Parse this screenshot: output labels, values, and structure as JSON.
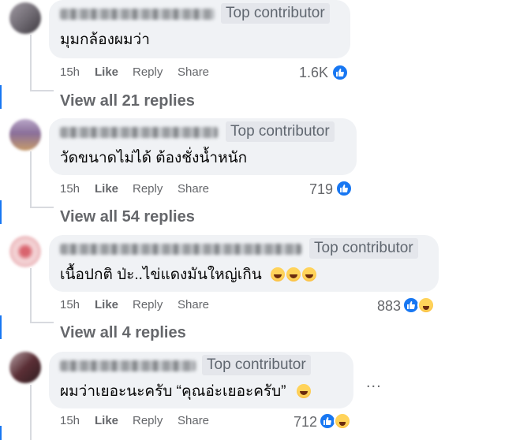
{
  "comments": [
    {
      "badge": "Top contributor",
      "text": "มุมกล้องผมว่า",
      "time": "15h",
      "like": "Like",
      "reply": "Reply",
      "share": "Share",
      "reaction_count": "1.6K",
      "reactions": [
        "like-icon"
      ],
      "view_replies": "View all 21 replies",
      "avatar_colors": [
        "#6d6870",
        "#a09aa3",
        "#3e3a40"
      ]
    },
    {
      "badge": "Top contributor",
      "text": "วัดขนาดไม่ได้ ต้องชั่งน้ำหนัก",
      "time": "15h",
      "like": "Like",
      "reply": "Reply",
      "share": "Share",
      "reaction_count": "719",
      "reactions": [
        "like-icon"
      ],
      "view_replies": "View all 54 replies",
      "avatar_colors": [
        "#8a6f9a",
        "#c69a6a",
        "#b9a6c8"
      ]
    },
    {
      "badge": "Top contributor",
      "text": "เนื้อปกติ ป่ะ..ไข่แดงมันใหญ่เกิน",
      "emoji_count": 3,
      "time": "15h",
      "like": "Like",
      "reply": "Reply",
      "share": "Share",
      "reaction_count": "883",
      "reactions": [
        "like-icon",
        "haha-icon"
      ],
      "view_replies": "View all 4 replies",
      "avatar_colors": [
        "#e6a3a8",
        "#f4d6d8",
        "#d9646e"
      ]
    },
    {
      "badge": "Top contributor",
      "text": "ผมว่าเยอะนะครับ “คุณอ่ะเยอะครับ”",
      "emoji_count": 1,
      "time": "15h",
      "like": "Like",
      "reply": "Reply",
      "share": "Share",
      "reaction_count": "712",
      "reactions": [
        "like-icon",
        "haha-icon"
      ],
      "more_options": "...",
      "avatar_colors": [
        "#5a2e35",
        "#b8a4a8",
        "#2e1d20"
      ]
    }
  ],
  "colors": {
    "bubble": "#f0f2f5",
    "badge_bg": "#e4e6eb",
    "meta_text": "#65676b",
    "like_blue": "#1877f2"
  }
}
